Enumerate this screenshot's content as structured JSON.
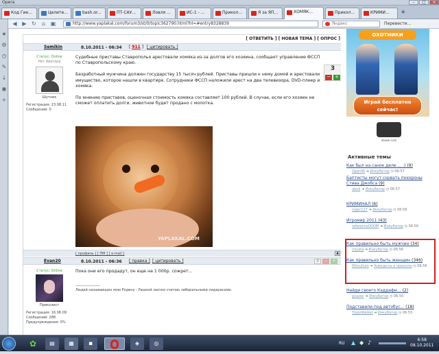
{
  "window": {
    "title": "Opera"
  },
  "tabs": [
    {
      "label": "Код Гие..."
    },
    {
      "label": "Целите..."
    },
    {
      "label": "bash.or..."
    },
    {
      "label": "ПТ-САУ..."
    },
    {
      "label": "Ловля ..."
    },
    {
      "label": "ИС-1 - ..."
    },
    {
      "label": "Прикол..."
    },
    {
      "label": "Я за ЯП..."
    },
    {
      "label": "ХОМЯК..."
    },
    {
      "label": "Прикол..."
    },
    {
      "label": "КРИМИ..."
    }
  ],
  "navbar": {
    "url": "http://www.yaplakal.com/forum3/st/0/topic362790.html?hl=#entry8328839",
    "search_placeholder": "Яндекс",
    "translate_label": "Перевести..."
  },
  "forum": {
    "actions": "[ ОТВЕТИТЬ ] [ НОВАЯ ТЕМА ] [ ОПРОС ]",
    "posts": [
      {
        "author": "Semikin",
        "date": "8.10.2011 - 06:34",
        "num": "911",
        "quote": "цитировать",
        "status": "Статус: Online",
        "avatar_caption": "Нет Аватара",
        "rank": "Шутник",
        "reg": "Регистрация: 23.08.11",
        "msgs": "Сообщений: 0",
        "vote": "3",
        "p1": "Судебные приставы Ставрополья арестовали хомяка из-за долгов его хозяина, сообщает управление ФССП по Ставропольскому краю.",
        "p2": "Безработный мужчина должен государству 15 тысяч рублей. Приставы пришли к нему домой и арестовали имущество, которое нашли в квартире. Сотрудники ФССП наложили арест на два телевизора, DVD-плеер и хомяка.",
        "p3": "По мнению приставов, оценочная стоимость хомяка составляет 100 рублей. В случае, если его хозяин не сможет оплатить долги, животное будет продано с молотка.",
        "watermark": "YAPLAKAL.COM",
        "footer": "[ профиль ] [ ПМ ] [ e-mail ]"
      },
      {
        "author": "Evan20",
        "date": "8.10.2011 - 06:36",
        "edit": "правка",
        "quote": "цитировать",
        "status": "Статус: Online",
        "rank": "Приколист",
        "reg": "Регистрация: 16.06.09",
        "msgs": "Сообщений: 288",
        "warn": "Предупреждения: 0%",
        "vote": "3",
        "text": "Пока они его продадут, он еще на 1 000р. сожрет...",
        "sig_sep": "--------------------",
        "signature": "Людей называющих мою Родину - Рашкой заочно считаю либеральными пидарасами."
      }
    ]
  },
  "ad": {
    "logo": "ОХОТНИКИ",
    "button": "Играй бесплатно сейчас!",
    "brand": "alawar.com"
  },
  "active_topics": {
    "title": "Активные темы",
    "items": [
      {
        "title": "Как был на санок деле ... :)",
        "count": "(9)",
        "user": "OpenMi",
        "arrow": "Инкубатор",
        "time": "06:57"
      },
      {
        "title": "Баптисты могут сорвать похороны Стива Джобса",
        "count": "(9)",
        "user": "ubuk",
        "arrow": "Инкубатор",
        "time": "06:57"
      },
      {
        "title": "КРИМИНАЛ",
        "count": "(6)",
        "user": "roger127",
        "arrow": "Инкубатор",
        "time": "06:56"
      },
      {
        "title": "Игромир 2011",
        "count": "(43)",
        "user": "reference0OOM",
        "arrow": "Инкубатор",
        "time": "06:56"
      },
      {
        "title": "Как правильно быть мужчин",
        "count": "(34)",
        "user": "Usyata",
        "arrow": "Инкубатор",
        "time": "06:56"
      },
      {
        "title": "Как правильно быть женщин",
        "count": "(346)",
        "user": "fillmullum",
        "arrow": "Анекдоты и приколы",
        "time": "06:56"
      },
      {
        "title": "Найди своего Каддафи...",
        "count": "(2)",
        "user": "gvazec",
        "arrow": "Инкубатор",
        "time": "06:55"
      },
      {
        "title": "Подставили под автобус...",
        "count": "(18)",
        "user": "TippoWalker",
        "arrow": "Инкубатор",
        "time": "06:55"
      }
    ]
  },
  "taskbar": {
    "lang": "RU",
    "time": "6:58",
    "date": "08.10.2011"
  }
}
